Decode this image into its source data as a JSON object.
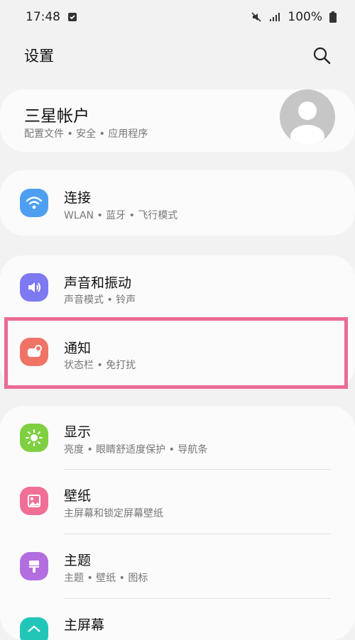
{
  "status_bar": {
    "time": "17:48",
    "battery": "100%",
    "icons": [
      "check-square-icon",
      "mute-icon",
      "signal-icon",
      "battery-icon"
    ]
  },
  "header": {
    "title": "设置",
    "search_icon": "search-icon"
  },
  "account": {
    "title": "三星帐户",
    "subtitle": "配置文件 • 安全 • 应用程序",
    "avatar_icon": "person-avatar-icon"
  },
  "items": [
    {
      "title": "连接",
      "subtitle": "WLAN • 蓝牙 • 飞行模式",
      "icon": "wifi-icon",
      "color": "#4f9ff1"
    },
    {
      "title": "声音和振动",
      "subtitle": "声音模式 • 铃声",
      "icon": "volume-icon",
      "color": "#7d79f0"
    },
    {
      "title": "通知",
      "subtitle": "状态栏 • 免打扰",
      "icon": "notification-icon",
      "color": "#f07466"
    },
    {
      "title": "显示",
      "subtitle": "亮度 • 眼睛舒适度保护 • 导航条",
      "icon": "brightness-icon",
      "color": "#7fd041"
    },
    {
      "title": "壁纸",
      "subtitle": "主屏幕和锁定屏幕壁纸",
      "icon": "wallpaper-icon",
      "color": "#f06f95"
    },
    {
      "title": "主题",
      "subtitle": "主题 • 壁纸 • 图标",
      "icon": "theme-brush-icon",
      "color": "#b36ee0"
    },
    {
      "title": "主屏幕",
      "icon": "home-screen-icon",
      "color": "#22c6b8"
    }
  ],
  "highlight_color": "#ea6b93"
}
